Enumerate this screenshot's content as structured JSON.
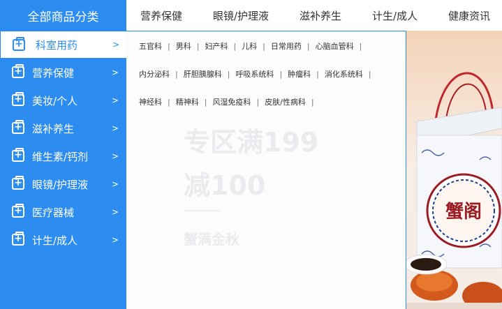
{
  "topnav": {
    "category_header": "全部商品分类",
    "links": [
      "营养保健",
      "眼镜/护理液",
      "滋补养生",
      "计生/成人",
      "健康资讯"
    ]
  },
  "sidebar": {
    "items": [
      {
        "label": "科室用药",
        "arrow": ">"
      },
      {
        "label": "营养保健",
        "arrow": ">"
      },
      {
        "label": "美妆/个人",
        "arrow": ">"
      },
      {
        "label": "滋补养生",
        "arrow": ">"
      },
      {
        "label": "维生素/钙剂",
        "arrow": ">"
      },
      {
        "label": "眼镜/护理液",
        "arrow": ">"
      },
      {
        "label": "医疗器械",
        "arrow": ">"
      },
      {
        "label": "计生/成人",
        "arrow": ">"
      }
    ]
  },
  "flyout": {
    "rows": [
      [
        "五官科",
        "男科",
        "妇产科",
        "儿科",
        "日常用药",
        "心脑血管科"
      ],
      [
        "内分泌科",
        "肝胆胰腺科",
        "呼吸系统科",
        "肿瘤科",
        "消化系统科"
      ],
      [
        "神经科",
        "精神科",
        "风湿免疫科",
        "皮肤/性病科"
      ]
    ],
    "separator": "|"
  },
  "banner": {
    "headline_1": "专区满199",
    "headline_2": "减100",
    "sub": "蟹满金秋",
    "box_text": "蟹阁"
  },
  "colors": {
    "accent": "#2d8cf0",
    "text": "#333333"
  },
  "icons": {
    "sidebar_item": "medicine-kit-icon",
    "arrow": "chevron-right-icon"
  }
}
